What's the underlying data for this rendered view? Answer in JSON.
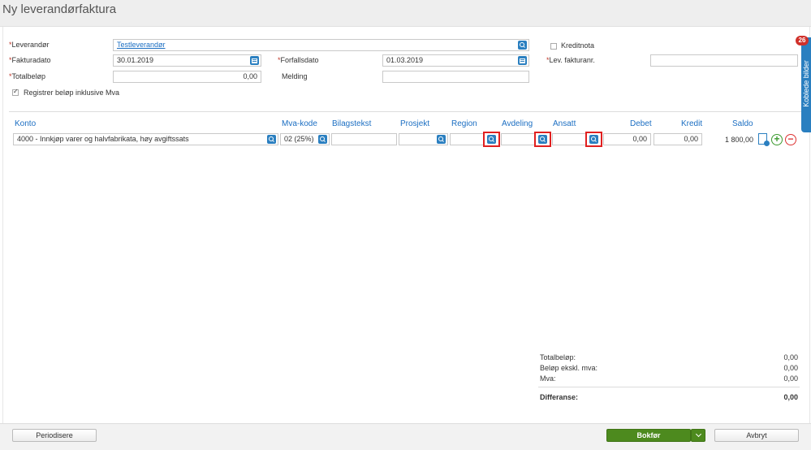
{
  "page": {
    "title": "Ny leverandørfaktura"
  },
  "form": {
    "leverandor": {
      "label": "Leverandør",
      "value": "Testleverandør"
    },
    "fakturadato": {
      "label": "Fakturadato",
      "value": "30.01.2019"
    },
    "totalbelop": {
      "label": "Totalbeløp",
      "value": "0,00"
    },
    "forfallsdato": {
      "label": "Forfallsdato",
      "value": "01.03.2019"
    },
    "melding": {
      "label": "Melding",
      "value": ""
    },
    "kreditnota": {
      "label": "Kreditnota",
      "checked": false
    },
    "lev_fakturanr": {
      "label": "Lev. fakturanr.",
      "value": ""
    },
    "registrer_mva": {
      "label": "Registrer beløp inklusive Mva",
      "checked": true
    },
    "required_mark": "*"
  },
  "table": {
    "columns": [
      "Konto",
      "Mva-kode",
      "Bilagstekst",
      "Prosjekt",
      "Region",
      "Avdeling",
      "Ansatt",
      "Debet",
      "Kredit",
      "Saldo"
    ],
    "row": {
      "konto": "4000 - Innkjøp varer og halvfabrikata, høy avgiftssats",
      "mva_kode": "02 (25%)",
      "bilagstekst": "",
      "prosjekt": "",
      "region": "",
      "avdeling": "",
      "ansatt": "",
      "debet": "0,00",
      "kredit": "0,00",
      "saldo": "1 800,00"
    }
  },
  "summary": {
    "totalbelop": {
      "label": "Totalbeløp:",
      "value": "0,00"
    },
    "ekskl_mva": {
      "label": "Beløp ekskl. mva:",
      "value": "0,00"
    },
    "mva": {
      "label": "Mva:",
      "value": "0,00"
    },
    "differanse": {
      "label": "Differanse:",
      "value": "0,00"
    }
  },
  "footer": {
    "periodisere": "Periodisere",
    "bokfor": "Bokfør",
    "avbryt": "Avbryt"
  },
  "sidebar": {
    "tab_label": "Koblede bilder",
    "badge": "26"
  },
  "icons": {
    "lookup": "magnifier-lookup-icon",
    "calendar": "calendar-icon",
    "attach": "attach-document-icon",
    "add": "plus-circle-icon",
    "remove": "minus-circle-icon",
    "dropdown": "chevron-down-icon"
  },
  "colors": {
    "accent": "#2a7fc0",
    "primary_button": "#4d8a1e",
    "highlight": "#e02020",
    "badge": "#d0302a"
  }
}
